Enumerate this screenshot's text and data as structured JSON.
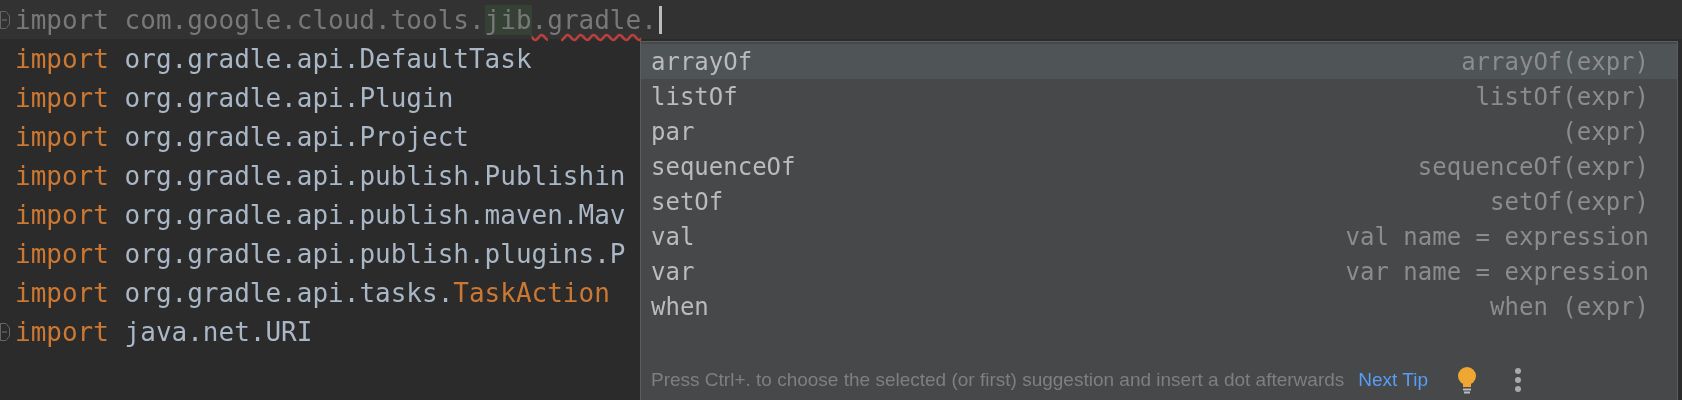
{
  "editor": {
    "lines": [
      {
        "fold": true,
        "cursor": true,
        "segments": [
          {
            "text": "import com.google.cloud.tools.",
            "kind": "unused"
          },
          {
            "text": "jib",
            "kind": "unused_match"
          },
          {
            "text": ".gradle",
            "kind": "unused_error"
          },
          {
            "text": ".",
            "kind": "unused"
          }
        ]
      },
      {
        "fold": false,
        "cursor": false,
        "segments": [
          {
            "text": "import",
            "kind": "keyword"
          },
          {
            "text": " org.gradle.api.DefaultTask",
            "kind": "text"
          }
        ]
      },
      {
        "fold": false,
        "cursor": false,
        "segments": [
          {
            "text": "import",
            "kind": "keyword"
          },
          {
            "text": " org.gradle.api.Plugin",
            "kind": "text"
          }
        ]
      },
      {
        "fold": false,
        "cursor": false,
        "segments": [
          {
            "text": "import",
            "kind": "keyword"
          },
          {
            "text": " org.gradle.api.Project",
            "kind": "text"
          }
        ]
      },
      {
        "fold": false,
        "cursor": false,
        "segments": [
          {
            "text": "import",
            "kind": "keyword"
          },
          {
            "text": " org.gradle.api.publish.Publishin",
            "kind": "text"
          }
        ]
      },
      {
        "fold": false,
        "cursor": false,
        "segments": [
          {
            "text": "import",
            "kind": "keyword"
          },
          {
            "text": " org.gradle.api.publish.maven.Mav",
            "kind": "text"
          }
        ]
      },
      {
        "fold": false,
        "cursor": false,
        "segments": [
          {
            "text": "import",
            "kind": "keyword"
          },
          {
            "text": " org.gradle.api.publish.plugins.P",
            "kind": "text"
          }
        ]
      },
      {
        "fold": false,
        "cursor": false,
        "segments": [
          {
            "text": "import",
            "kind": "keyword"
          },
          {
            "text": " org.gradle.api.tasks.",
            "kind": "text"
          },
          {
            "text": "TaskAction",
            "kind": "class"
          }
        ]
      },
      {
        "fold": true,
        "cursor": false,
        "segments": [
          {
            "text": "import",
            "kind": "keyword"
          },
          {
            "text": " java.net.URI",
            "kind": "text"
          }
        ]
      }
    ]
  },
  "completion": {
    "items": [
      {
        "name": "arrayOf",
        "detail": "arrayOf(expr)",
        "selected": true
      },
      {
        "name": "listOf",
        "detail": "listOf(expr)",
        "selected": false
      },
      {
        "name": "par",
        "detail": "(expr)",
        "selected": false
      },
      {
        "name": "sequenceOf",
        "detail": "sequenceOf(expr)",
        "selected": false
      },
      {
        "name": "setOf",
        "detail": "setOf(expr)",
        "selected": false
      },
      {
        "name": "val",
        "detail": "val name = expression",
        "selected": false
      },
      {
        "name": "var",
        "detail": "var name = expression",
        "selected": false
      },
      {
        "name": "when",
        "detail": "when (expr)",
        "selected": false
      }
    ],
    "tip": "Press Ctrl+. to choose the selected (or first) suggestion and insert a dot afterwards",
    "next_tip": "Next Tip"
  }
}
